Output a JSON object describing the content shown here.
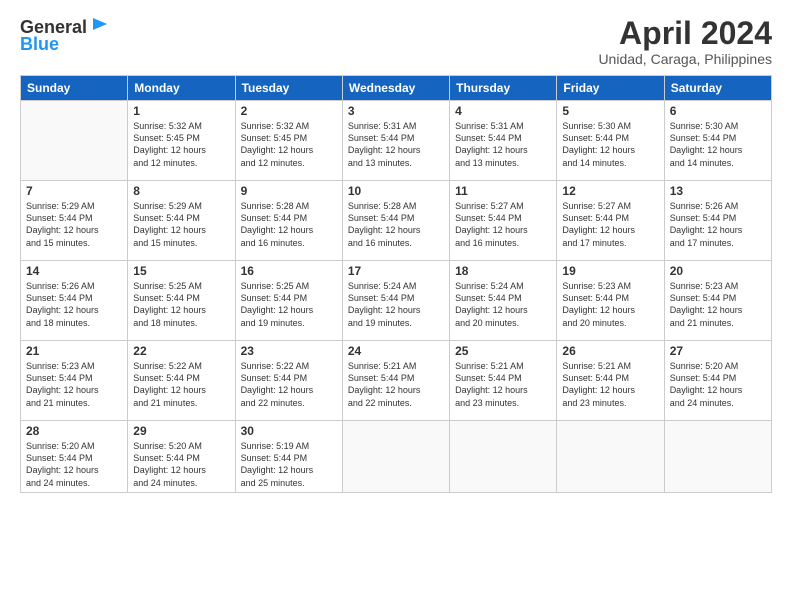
{
  "header": {
    "logo_line1": "General",
    "logo_line2": "Blue",
    "month_title": "April 2024",
    "subtitle": "Unidad, Caraga, Philippines"
  },
  "weekdays": [
    "Sunday",
    "Monday",
    "Tuesday",
    "Wednesday",
    "Thursday",
    "Friday",
    "Saturday"
  ],
  "weeks": [
    [
      {
        "num": "",
        "info": ""
      },
      {
        "num": "1",
        "info": "Sunrise: 5:32 AM\nSunset: 5:45 PM\nDaylight: 12 hours\nand 12 minutes."
      },
      {
        "num": "2",
        "info": "Sunrise: 5:32 AM\nSunset: 5:45 PM\nDaylight: 12 hours\nand 12 minutes."
      },
      {
        "num": "3",
        "info": "Sunrise: 5:31 AM\nSunset: 5:44 PM\nDaylight: 12 hours\nand 13 minutes."
      },
      {
        "num": "4",
        "info": "Sunrise: 5:31 AM\nSunset: 5:44 PM\nDaylight: 12 hours\nand 13 minutes."
      },
      {
        "num": "5",
        "info": "Sunrise: 5:30 AM\nSunset: 5:44 PM\nDaylight: 12 hours\nand 14 minutes."
      },
      {
        "num": "6",
        "info": "Sunrise: 5:30 AM\nSunset: 5:44 PM\nDaylight: 12 hours\nand 14 minutes."
      }
    ],
    [
      {
        "num": "7",
        "info": "Sunrise: 5:29 AM\nSunset: 5:44 PM\nDaylight: 12 hours\nand 15 minutes."
      },
      {
        "num": "8",
        "info": "Sunrise: 5:29 AM\nSunset: 5:44 PM\nDaylight: 12 hours\nand 15 minutes."
      },
      {
        "num": "9",
        "info": "Sunrise: 5:28 AM\nSunset: 5:44 PM\nDaylight: 12 hours\nand 16 minutes."
      },
      {
        "num": "10",
        "info": "Sunrise: 5:28 AM\nSunset: 5:44 PM\nDaylight: 12 hours\nand 16 minutes."
      },
      {
        "num": "11",
        "info": "Sunrise: 5:27 AM\nSunset: 5:44 PM\nDaylight: 12 hours\nand 16 minutes."
      },
      {
        "num": "12",
        "info": "Sunrise: 5:27 AM\nSunset: 5:44 PM\nDaylight: 12 hours\nand 17 minutes."
      },
      {
        "num": "13",
        "info": "Sunrise: 5:26 AM\nSunset: 5:44 PM\nDaylight: 12 hours\nand 17 minutes."
      }
    ],
    [
      {
        "num": "14",
        "info": "Sunrise: 5:26 AM\nSunset: 5:44 PM\nDaylight: 12 hours\nand 18 minutes."
      },
      {
        "num": "15",
        "info": "Sunrise: 5:25 AM\nSunset: 5:44 PM\nDaylight: 12 hours\nand 18 minutes."
      },
      {
        "num": "16",
        "info": "Sunrise: 5:25 AM\nSunset: 5:44 PM\nDaylight: 12 hours\nand 19 minutes."
      },
      {
        "num": "17",
        "info": "Sunrise: 5:24 AM\nSunset: 5:44 PM\nDaylight: 12 hours\nand 19 minutes."
      },
      {
        "num": "18",
        "info": "Sunrise: 5:24 AM\nSunset: 5:44 PM\nDaylight: 12 hours\nand 20 minutes."
      },
      {
        "num": "19",
        "info": "Sunrise: 5:23 AM\nSunset: 5:44 PM\nDaylight: 12 hours\nand 20 minutes."
      },
      {
        "num": "20",
        "info": "Sunrise: 5:23 AM\nSunset: 5:44 PM\nDaylight: 12 hours\nand 21 minutes."
      }
    ],
    [
      {
        "num": "21",
        "info": "Sunrise: 5:23 AM\nSunset: 5:44 PM\nDaylight: 12 hours\nand 21 minutes."
      },
      {
        "num": "22",
        "info": "Sunrise: 5:22 AM\nSunset: 5:44 PM\nDaylight: 12 hours\nand 21 minutes."
      },
      {
        "num": "23",
        "info": "Sunrise: 5:22 AM\nSunset: 5:44 PM\nDaylight: 12 hours\nand 22 minutes."
      },
      {
        "num": "24",
        "info": "Sunrise: 5:21 AM\nSunset: 5:44 PM\nDaylight: 12 hours\nand 22 minutes."
      },
      {
        "num": "25",
        "info": "Sunrise: 5:21 AM\nSunset: 5:44 PM\nDaylight: 12 hours\nand 23 minutes."
      },
      {
        "num": "26",
        "info": "Sunrise: 5:21 AM\nSunset: 5:44 PM\nDaylight: 12 hours\nand 23 minutes."
      },
      {
        "num": "27",
        "info": "Sunrise: 5:20 AM\nSunset: 5:44 PM\nDaylight: 12 hours\nand 24 minutes."
      }
    ],
    [
      {
        "num": "28",
        "info": "Sunrise: 5:20 AM\nSunset: 5:44 PM\nDaylight: 12 hours\nand 24 minutes."
      },
      {
        "num": "29",
        "info": "Sunrise: 5:20 AM\nSunset: 5:44 PM\nDaylight: 12 hours\nand 24 minutes."
      },
      {
        "num": "30",
        "info": "Sunrise: 5:19 AM\nSunset: 5:44 PM\nDaylight: 12 hours\nand 25 minutes."
      },
      {
        "num": "",
        "info": ""
      },
      {
        "num": "",
        "info": ""
      },
      {
        "num": "",
        "info": ""
      },
      {
        "num": "",
        "info": ""
      }
    ]
  ]
}
